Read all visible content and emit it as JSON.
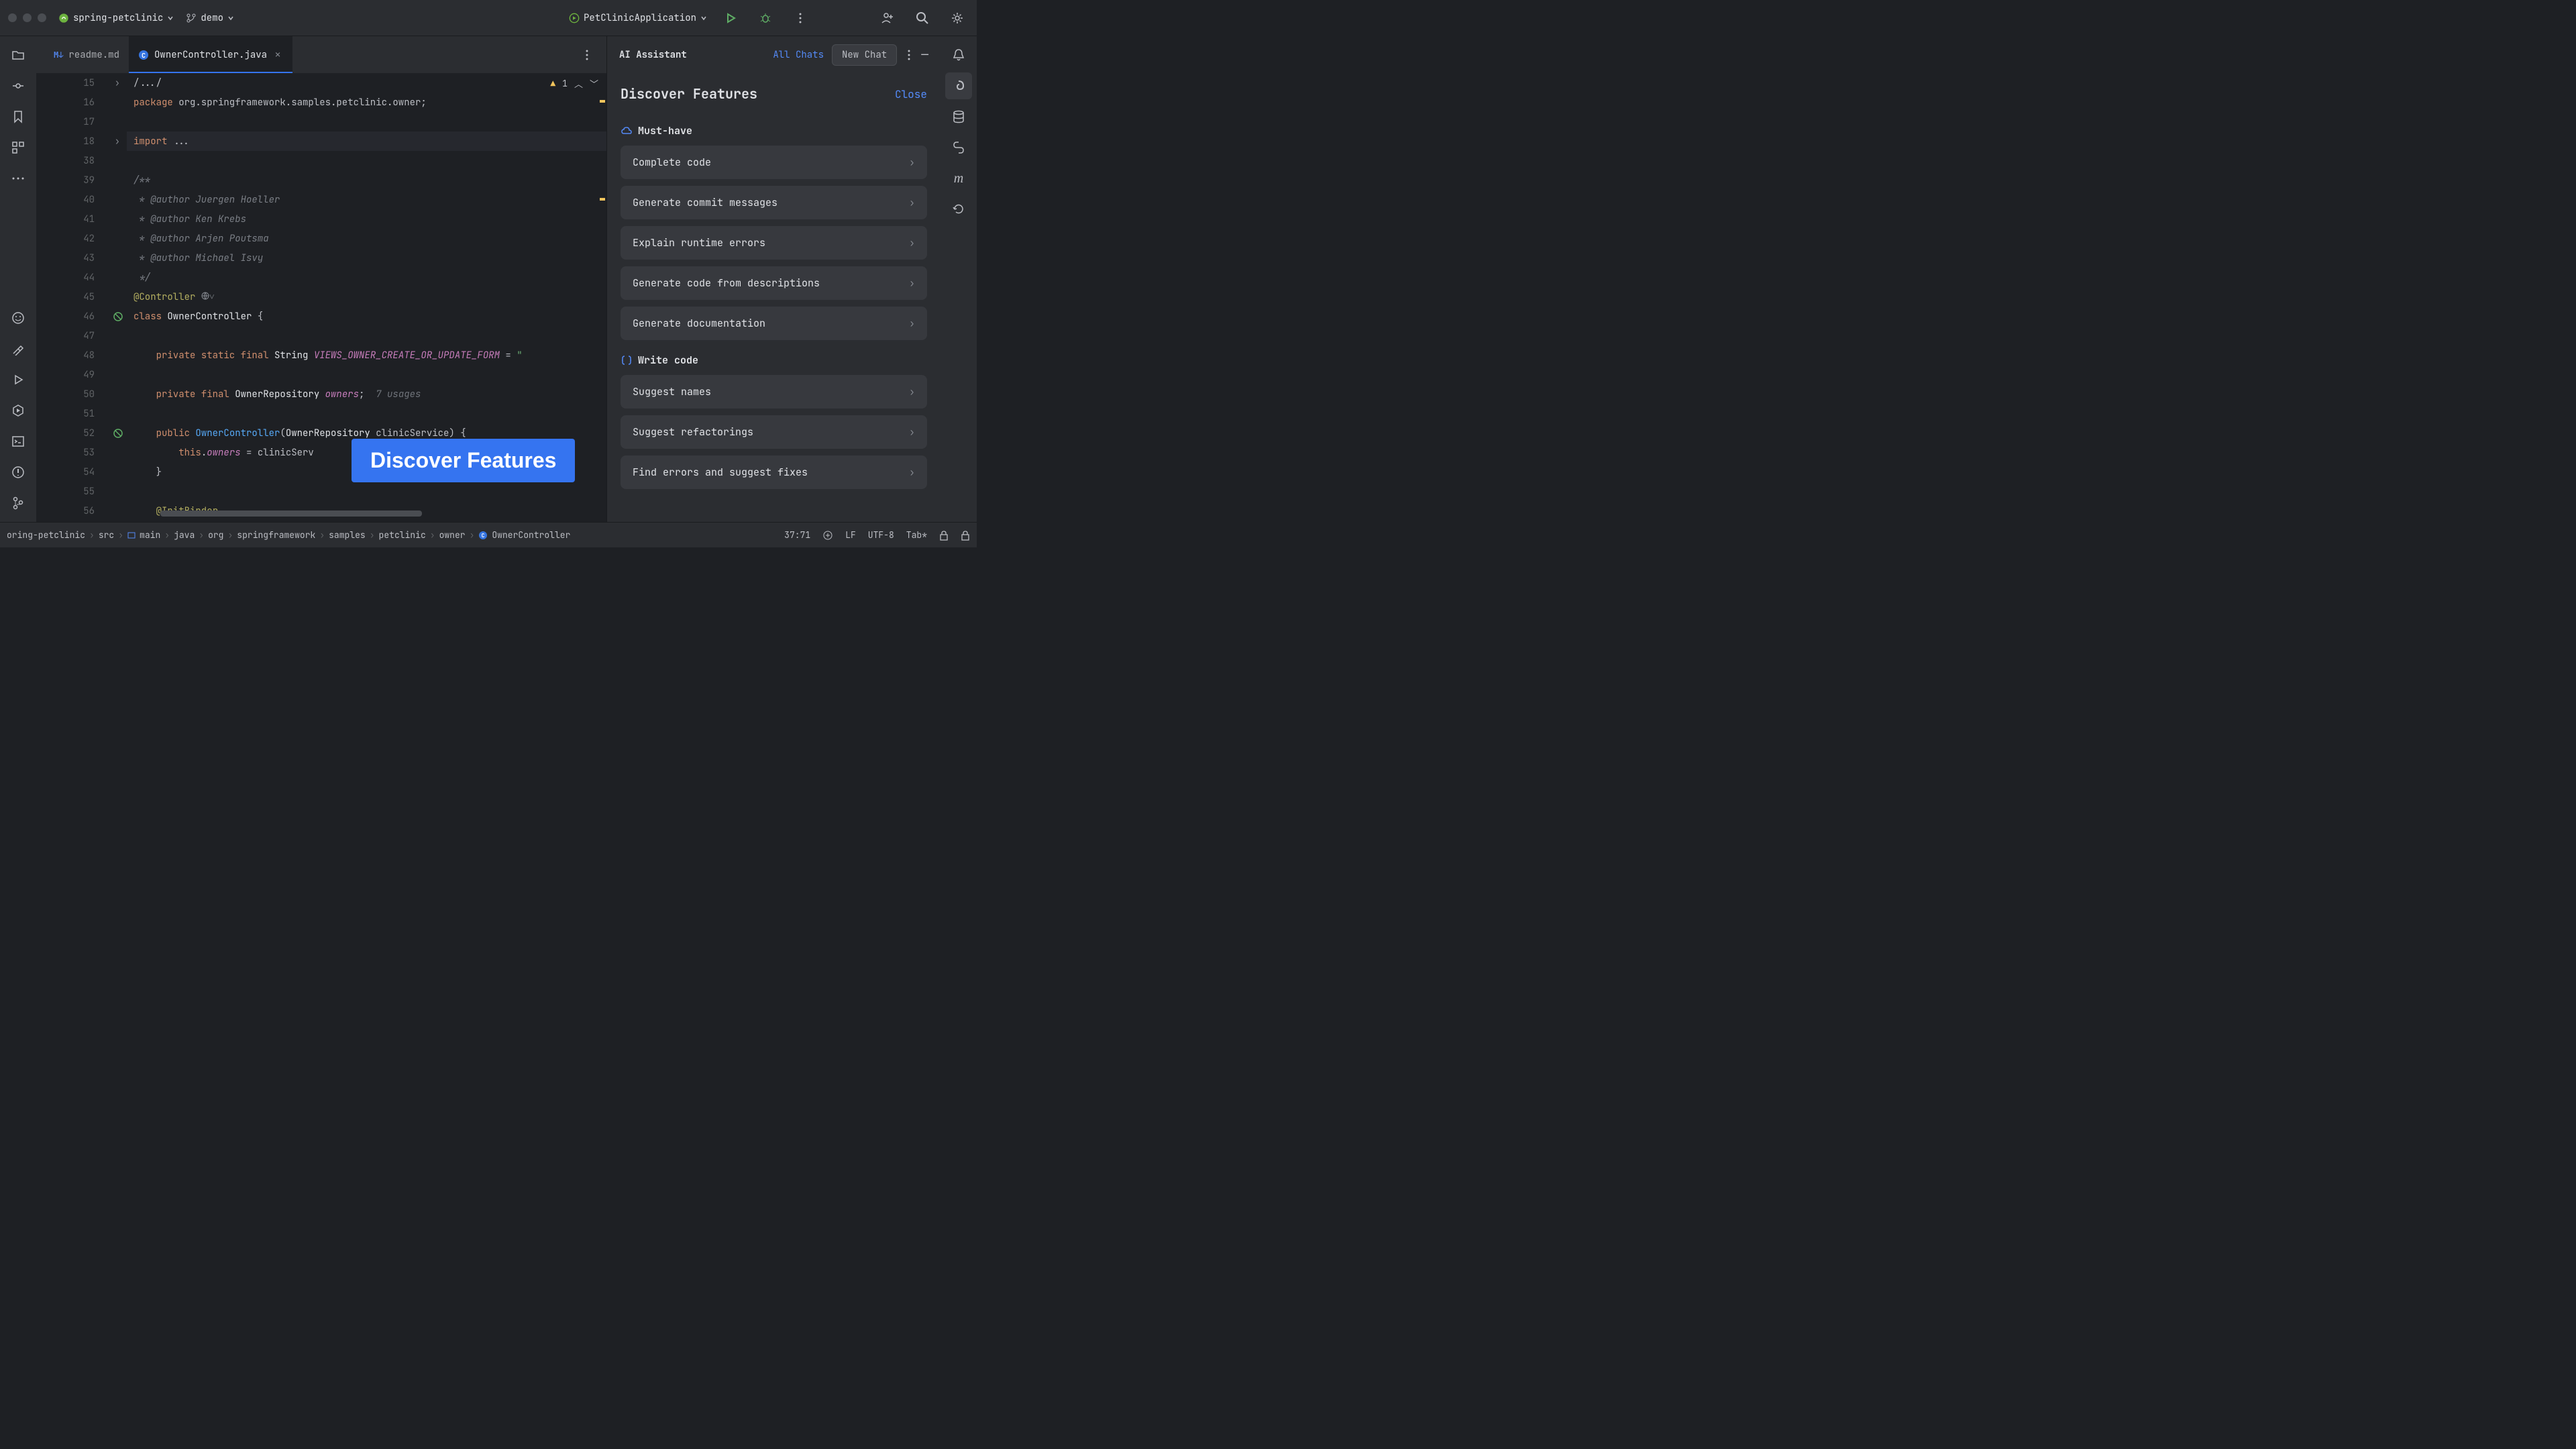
{
  "titlebar": {
    "project": "spring-petclinic",
    "branch": "demo",
    "run_config": "PetClinicApplication"
  },
  "tabs": [
    {
      "label": "readme.md",
      "icon": "md",
      "active": false
    },
    {
      "label": "OwnerController.java",
      "icon": "java-class",
      "active": true
    }
  ],
  "editor": {
    "warning_count": "1",
    "lines": [
      {
        "n": "15",
        "text": "/.../",
        "fold": true
      },
      {
        "n": "16",
        "segs": [
          [
            "k",
            "package"
          ],
          [
            "",
            " org.springframework.samples.petclinic.owner"
          ],
          [
            "",
            ";"
          ]
        ]
      },
      {
        "n": "17",
        "text": ""
      },
      {
        "n": "18",
        "segs": [
          [
            "k",
            "import"
          ],
          [
            "",
            " "
          ],
          [
            "",
            "..."
          ]
        ],
        "fold": true,
        "hl": true
      },
      {
        "n": "38",
        "text": ""
      },
      {
        "n": "39",
        "segs": [
          [
            "cmt",
            "/**"
          ]
        ]
      },
      {
        "n": "40",
        "segs": [
          [
            "cmt",
            " * @author Juergen Hoeller"
          ]
        ]
      },
      {
        "n": "41",
        "segs": [
          [
            "cmt",
            " * @author Ken Krebs"
          ]
        ]
      },
      {
        "n": "42",
        "segs": [
          [
            "cmt",
            " * @author Arjen Poutsma"
          ]
        ]
      },
      {
        "n": "43",
        "segs": [
          [
            "cmt",
            " * @author Michael Isvy"
          ]
        ]
      },
      {
        "n": "44",
        "segs": [
          [
            "cmt",
            " */"
          ]
        ]
      },
      {
        "n": "45",
        "segs": [
          [
            "ann",
            "@Controller"
          ]
        ],
        "web": true
      },
      {
        "n": "46",
        "segs": [
          [
            "k",
            "class"
          ],
          [
            "",
            " "
          ],
          [
            "cls",
            "OwnerController"
          ],
          [
            "",
            " {"
          ]
        ],
        "icon": "no-entry"
      },
      {
        "n": "47",
        "text": ""
      },
      {
        "n": "48",
        "segs": [
          [
            "",
            "    "
          ],
          [
            "k",
            "private static final"
          ],
          [
            "",
            " "
          ],
          [
            "cls",
            "String"
          ],
          [
            "",
            " "
          ],
          [
            "fld",
            "VIEWS_OWNER_CREATE_OR_UPDATE_FORM"
          ],
          [
            "",
            " = "
          ],
          [
            "str",
            "\""
          ]
        ]
      },
      {
        "n": "49",
        "text": ""
      },
      {
        "n": "50",
        "segs": [
          [
            "",
            "    "
          ],
          [
            "k",
            "private final"
          ],
          [
            "",
            " "
          ],
          [
            "cls",
            "OwnerRepository"
          ],
          [
            "",
            " "
          ],
          [
            "fld",
            "owners"
          ],
          [
            "",
            ";  "
          ],
          [
            "hint",
            "7 usages"
          ]
        ]
      },
      {
        "n": "51",
        "text": ""
      },
      {
        "n": "52",
        "segs": [
          [
            "",
            "    "
          ],
          [
            "k",
            "public"
          ],
          [
            "",
            " "
          ],
          [
            "mth",
            "OwnerController"
          ],
          [
            "",
            "("
          ],
          [
            "cls",
            "OwnerRepository"
          ],
          [
            "",
            " clinicService) {"
          ]
        ],
        "icon": "no-entry"
      },
      {
        "n": "53",
        "segs": [
          [
            "",
            "        "
          ],
          [
            "k",
            "this"
          ],
          [
            "",
            "."
          ],
          [
            "fld",
            "owners"
          ],
          [
            "",
            " = clinicServ"
          ]
        ]
      },
      {
        "n": "54",
        "text": "    }"
      },
      {
        "n": "55",
        "text": ""
      },
      {
        "n": "56",
        "segs": [
          [
            "",
            "    "
          ],
          [
            "ann",
            "@InitBinder"
          ]
        ]
      }
    ]
  },
  "callout": {
    "text": "Discover Features"
  },
  "ai": {
    "header": {
      "title": "AI Assistant",
      "all_chats": "All Chats",
      "new_chat": "New Chat"
    },
    "page_title": "Discover Features",
    "close": "Close",
    "sections": [
      {
        "title": "Must-have",
        "icon": "cloud",
        "items": [
          "Complete code",
          "Generate commit messages",
          "Explain runtime errors",
          "Generate code from descriptions",
          "Generate documentation"
        ]
      },
      {
        "title": "Write code",
        "icon": "braces",
        "items": [
          "Suggest names",
          "Suggest refactorings",
          "Find errors and suggest fixes"
        ]
      }
    ]
  },
  "breadcrumbs": [
    "oring-petclinic",
    "src",
    "main",
    "java",
    "org",
    "springframework",
    "samples",
    "petclinic",
    "owner",
    "OwnerController"
  ],
  "status": {
    "pos": "37:71",
    "enc": "UTF-8",
    "eol": "LF",
    "indent": "Tab*"
  }
}
